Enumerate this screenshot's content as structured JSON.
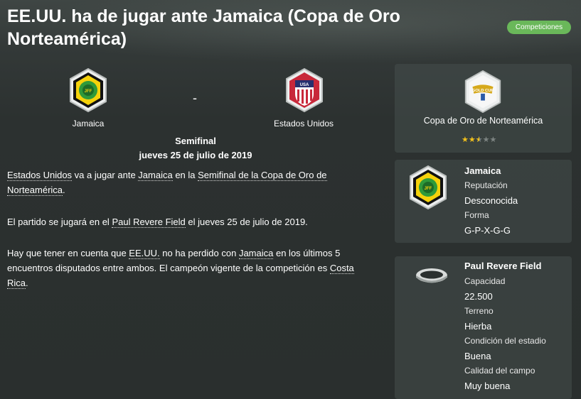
{
  "header": {
    "title": "EE.UU. ha de jugar ante Jamaica (Copa de Oro Norteamérica)",
    "badge": "Competiciones"
  },
  "match": {
    "home_team": "Jamaica",
    "away_team": "Estados Unidos",
    "separator": "-",
    "round": "Semifinal",
    "date": "jueves 25 de julio de 2019"
  },
  "article": {
    "p1": {
      "team_a": "Estados Unidos",
      "t1": " va a jugar ante ",
      "team_b": "Jamaica",
      "t2": " en la ",
      "comp": "Semifinal de la Copa de Oro de Norteamérica",
      "t3": "."
    },
    "p2": {
      "t1": "El partido se jugará en el ",
      "venue": "Paul Revere Field",
      "t2": " el jueves 25 de julio de 2019."
    },
    "p3": {
      "t1": "Hay que tener en cuenta que ",
      "team_a": "EE.UU.",
      "t2": " no ha perdido con ",
      "team_b": "Jamaica",
      "t3": " en los últimos 5 encuentros disputados entre ambos. El campeón vigente de la competición es ",
      "champion": "Costa Rica",
      "t4": "."
    }
  },
  "competition_panel": {
    "name": "Copa de Oro de Norteamérica",
    "rating": 2.5,
    "rating_max": 5,
    "stars": [
      "★",
      "★",
      "★",
      "★",
      "★"
    ]
  },
  "team_panel": {
    "name": "Jamaica",
    "reputation_label": "Reputación",
    "reputation_value": "Desconocida",
    "form_label": "Forma",
    "form_value": "G-P-X-G-G"
  },
  "stadium_panel": {
    "name": "Paul Revere Field",
    "capacity_label": "Capacidad",
    "capacity_value": "22.500",
    "surface_label": "Terreno",
    "surface_value": "Hierba",
    "condition_label": "Condición del estadio",
    "condition_value": "Buena",
    "pitch_label": "Calidad del campo",
    "pitch_value": "Muy buena"
  },
  "colors": {
    "badge": "#6ab85a",
    "star_on": "#f2c11b",
    "jamaica_green": "#2f9a3a",
    "jamaica_yellow": "#f5d20b",
    "usa_red": "#c8283a",
    "usa_blue": "#27306e"
  },
  "icons": {
    "jamaica_crest": "jamaica-federation-crest-icon",
    "usa_crest": "us-soccer-crest-icon",
    "comp_logo": "gold-cup-logo-icon",
    "stadium": "stadium-icon"
  }
}
